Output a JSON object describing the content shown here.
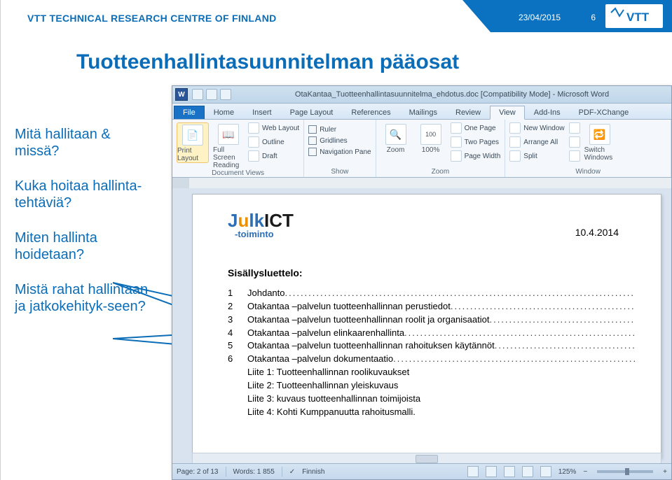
{
  "header": {
    "org": "VTT TECHNICAL RESEARCH CENTRE OF FINLAND",
    "date": "23/04/2015",
    "page_number": "6",
    "logo_alt": "VTT"
  },
  "slide": {
    "title": "Tuotteenhallintasuunnitelman pääosat",
    "questions": {
      "q1": "Mitä hallitaan & missä?",
      "q2": "Kuka hoitaa hallinta-tehtäviä?",
      "q3": "Miten hallinta hoidetaan?",
      "q4": "Mistä rahat hallintaan ja jatkokehityk-seen?"
    }
  },
  "word": {
    "title": "OtaKantaa_Tuotteenhallintasuunnitelma_ehdotus.doc [Compatibility Mode]  -  Microsoft Word",
    "tabs": {
      "file": "File",
      "home": "Home",
      "insert": "Insert",
      "pagelayout": "Page Layout",
      "references": "References",
      "mailings": "Mailings",
      "review": "Review",
      "view": "View",
      "addins": "Add-Ins",
      "pdfx": "PDF-XChange"
    },
    "ribbon": {
      "doc_views": {
        "print_layout": "Print Layout",
        "full_screen": "Full Screen Reading",
        "web_layout": "Web Layout",
        "outline": "Outline",
        "draft": "Draft",
        "group_label": "Document Views"
      },
      "show": {
        "ruler": "Ruler",
        "gridlines": "Gridlines",
        "navigation": "Navigation Pane",
        "group_label": "Show"
      },
      "zoom": {
        "zoom": "Zoom",
        "p100": "100%",
        "one_page": "One Page",
        "two_pages": "Two Pages",
        "page_width": "Page Width",
        "group_label": "Zoom"
      },
      "window": {
        "new_window": "New Window",
        "arrange_all": "Arrange All",
        "split": "Split",
        "switch_windows": "Switch Windows",
        "group_label": "Window"
      }
    },
    "document": {
      "brand": "JulkICT",
      "brand_sub": "-toiminto",
      "doc_date": "10.4.2014",
      "toc_title": "Sisällysluettelo:",
      "toc": [
        {
          "n": "1",
          "t": "Johdanto"
        },
        {
          "n": "2",
          "t": "Otakantaa –palvelun tuotteenhallinnan perustiedot"
        },
        {
          "n": "3",
          "t": "Otakantaa –palvelun tuotteenhallinnan roolit ja organisaatiot"
        },
        {
          "n": "4",
          "t": "Otakantaa –palvelun elinkaarenhallinta"
        },
        {
          "n": "5",
          "t": "Otakantaa –palvelun tuotteenhallinnan rahoituksen käytännöt"
        },
        {
          "n": "6",
          "t": "Otakantaa –palvelun dokumentaatio"
        }
      ],
      "appendices": [
        "Liite 1: Tuotteenhallinnan roolikuvaukset",
        "Liite 2: Tuotteenhallinnan yleiskuvaus",
        "Liite 3: kuvaus tuotteenhallinnan toimijoista",
        "Liite 4: Kohti Kumppanuutta rahoitusmalli."
      ]
    },
    "status": {
      "page": "Page: 2 of 13",
      "words": "Words: 1 855",
      "lang": "Finnish",
      "zoom": "125%"
    }
  }
}
